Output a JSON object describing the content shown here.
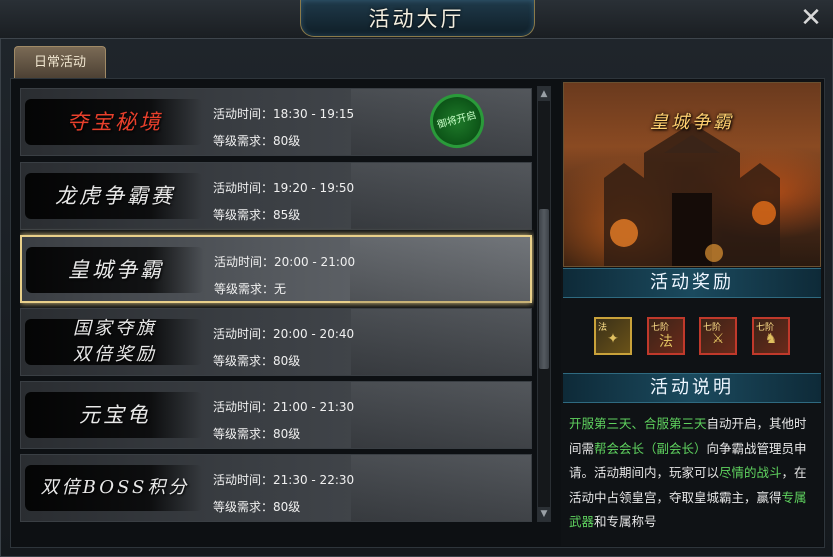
{
  "window": {
    "title": "活动大厅",
    "close_symbol": "✕"
  },
  "tabs": [
    {
      "label": "日常活动"
    }
  ],
  "activities": [
    {
      "name": "夺宝秘境",
      "time_label": "活动时间：",
      "time": "18:30 - 19:15",
      "req_label": "等级需求：",
      "req": "80级",
      "stamp": "御将开启"
    },
    {
      "name": "龙虎争霸赛",
      "time_label": "活动时间：",
      "time": "19:20 - 19:50",
      "req_label": "等级需求：",
      "req": "85级"
    },
    {
      "name": "皇城争霸",
      "time_label": "活动时间：",
      "time": "20:00 - 21:00",
      "req_label": "等级需求：",
      "req": "无",
      "selected": true
    },
    {
      "name": "国家夺旗 双倍奖励",
      "time_label": "活动时间：",
      "time": "20:00 - 20:40",
      "req_label": "等级需求：",
      "req": "80级"
    },
    {
      "name": "元宝龟",
      "time_label": "活动时间：",
      "time": "21:00 - 21:30",
      "req_label": "等级需求：",
      "req": "80级"
    },
    {
      "name": "双倍BOSS积分",
      "time_label": "活动时间：",
      "time": "21:30 - 22:30",
      "req_label": "等级需求：",
      "req": "80级"
    }
  ],
  "detail": {
    "preview_title": "皇城争霸",
    "rewards_header": "活动奖励",
    "rewards": [
      {
        "tag": "法",
        "symbol": "✦",
        "style": "gold"
      },
      {
        "tag": "七阶",
        "symbol": "法",
        "style": "red"
      },
      {
        "tag": "七阶",
        "symbol": "⚔",
        "style": "red"
      },
      {
        "tag": "七阶",
        "symbol": "♞",
        "style": "red"
      }
    ],
    "description_header": "活动说明",
    "description": {
      "p1": "开服第三天、合服第三天",
      "p2": "自动开启，其他时间需",
      "p3": "帮会会长（副会长）",
      "p4": "向争霸战管理员申请。活动期间内，玩家可以",
      "p5": "尽情的战斗",
      "p6": "，在活动中占领皇宫，夺取皇城霸主，赢得",
      "p7": "专属武器",
      "p8": "和专属称号"
    }
  },
  "colors": {
    "selected_border": "#e9d08a",
    "highlight_green": "#5fd35f",
    "highlight_orange": "#ff9a2a",
    "header_teal": "#1b4a5e"
  }
}
